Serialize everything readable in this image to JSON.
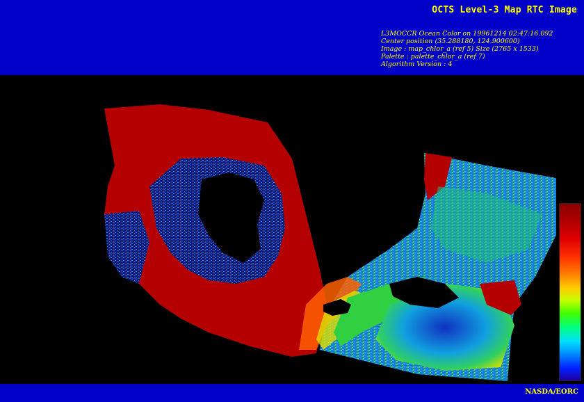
{
  "header": {
    "title": "OCTS Level-3 Map RTC Image",
    "meta_lines": [
      "L3MOCCR Ocean Color on 19961214 02:47:16.092",
      "Center position (35.288180, 124.900600)",
      "Image : map_chlor_a (ref 5) Size (2765 x 1533)",
      "Palette : palette_chlor_a (ref 7)",
      "Algorithm Version : 4"
    ]
  },
  "colors": {
    "banner": "#0000c8",
    "text": "#ffff00",
    "background": "#000000"
  },
  "colorbar": {
    "palette": "chlorophyll-a rainbow (dark red top, violet bottom)"
  },
  "footer": {
    "credit": "NASDA/EORC"
  }
}
